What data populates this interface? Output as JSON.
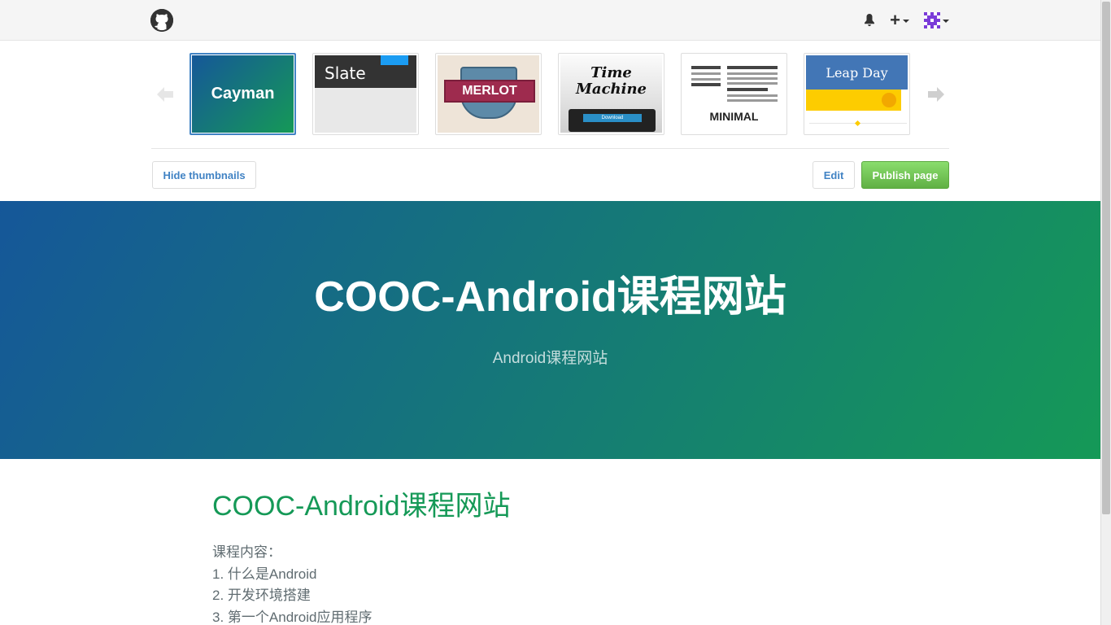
{
  "topbar": {
    "logo": "github-octocat-icon",
    "icons": [
      "bell-icon",
      "plus-icon",
      "avatar"
    ],
    "plus_label": "+"
  },
  "theme_picker": {
    "themes": [
      {
        "name": "Cayman",
        "selected": true
      },
      {
        "name": "Slate"
      },
      {
        "name": "MERLOT"
      },
      {
        "name": "Time Machine",
        "line1": "Time",
        "line2": "Machine",
        "button": "Download"
      },
      {
        "name": "MINIMAL"
      },
      {
        "name": "Leap Day"
      }
    ],
    "prev_icon": "arrow-left-icon",
    "next_icon": "arrow-right-icon"
  },
  "actions": {
    "hide_thumbnails": "Hide thumbnails",
    "edit": "Edit",
    "publish": "Publish page"
  },
  "hero": {
    "title": "COOC-Android课程网站",
    "tagline": "Android课程网站"
  },
  "content": {
    "heading": "COOC-Android课程网站",
    "lines": [
      "课程内容：",
      "1. 什么是Android",
      "2. 开发环境搭建",
      "3. 第一个Android应用程序"
    ]
  },
  "colors": {
    "accent": "#4183c4",
    "publish": "#60b044",
    "hero_start": "#155799",
    "hero_end": "#159957",
    "heading": "#159957"
  }
}
